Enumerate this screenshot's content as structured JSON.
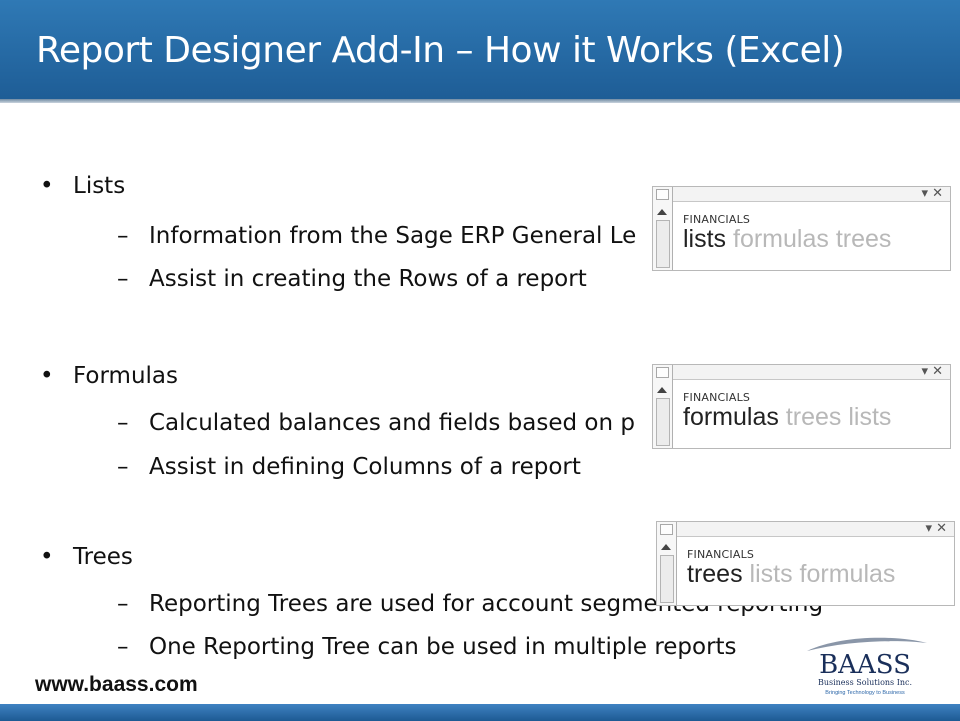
{
  "slide": {
    "title": "Report Designer Add-In – How it Works (Excel)",
    "website": "www.baass.com",
    "sections": [
      {
        "heading": "Lists",
        "items": [
          "Information from the Sage ERP General Le",
          "Assist in creating the Rows of a report"
        ]
      },
      {
        "heading": "Formulas",
        "items": [
          "Calculated balances and fields based on p",
          "Assist in defining Columns of a report"
        ]
      },
      {
        "heading": "Trees",
        "items": [
          "Reporting Trees are used for account segmented reporting",
          "One Reporting Tree can be used in multiple reports"
        ]
      }
    ]
  },
  "panes": [
    {
      "label": "FINANCIALS",
      "active": "lists",
      "others": " formulas trees",
      "controls": "▾ ✕"
    },
    {
      "label": "FINANCIALS",
      "active": "formulas",
      "others": " trees lists",
      "controls": "▾ ✕"
    },
    {
      "label": "FINANCIALS",
      "active": "trees",
      "others": " lists formulas",
      "controls": "▾ ✕"
    }
  ],
  "logo": {
    "name": "BAASS",
    "company": "Business Solutions Inc.",
    "tagline": "Bringing Technology to Business",
    "colors": {
      "text": "#1a2f5a",
      "swoosh": "#8a96a8",
      "tagline": "#2b66a8"
    }
  },
  "theme": {
    "title_bar": "#2f79b5",
    "bottom_bar": "#2a6aa8",
    "text": "#111111",
    "pane_inactive_text": "#b8b8b8"
  }
}
